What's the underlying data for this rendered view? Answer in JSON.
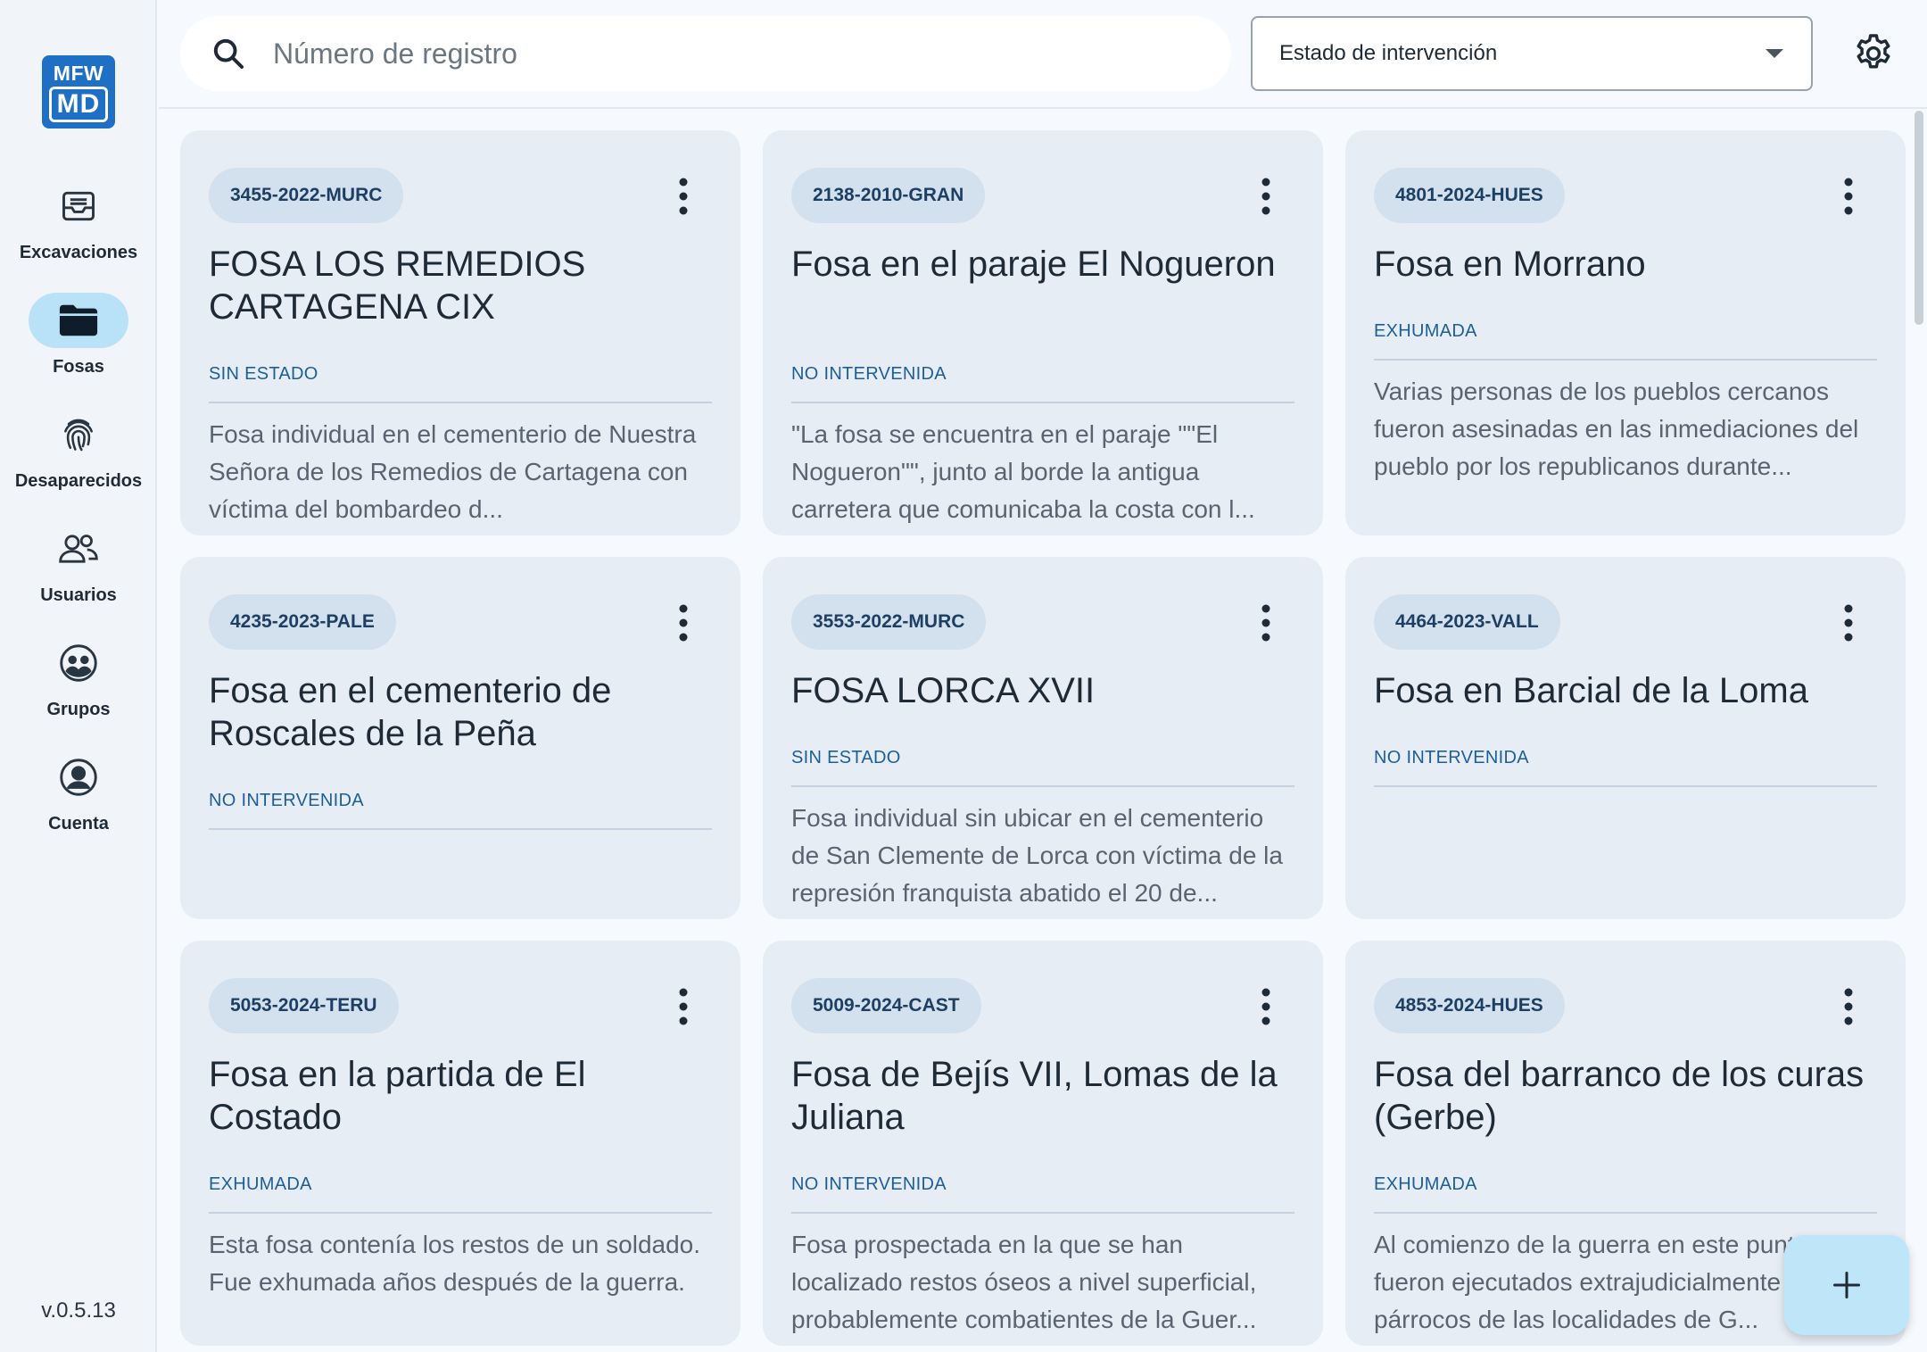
{
  "app": {
    "logo_top": "MFW",
    "logo_bottom": "MD",
    "version": "v.0.5.13"
  },
  "sidebar": {
    "items": [
      {
        "label": "Excavaciones",
        "icon": "inbox-icon"
      },
      {
        "label": "Fosas",
        "icon": "folder-icon",
        "active": true
      },
      {
        "label": "Desaparecidos",
        "icon": "fingerprint-icon"
      },
      {
        "label": "Usuarios",
        "icon": "users-icon"
      },
      {
        "label": "Grupos",
        "icon": "group-icon"
      },
      {
        "label": "Cuenta",
        "icon": "account-icon"
      }
    ]
  },
  "search": {
    "placeholder": "Número de registro",
    "value": ""
  },
  "filter": {
    "selected": "Estado de intervención"
  },
  "colors": {
    "accent": "#1f6fc5",
    "card_bg": "#e7edf5",
    "chip_bg": "#d3e0ee",
    "status": "#1d5e9a",
    "active_nav": "#b9e1f7"
  },
  "cards": [
    {
      "code": "3455-2022-MURC",
      "title": "FOSA LOS REMEDIOS CARTAGENA CIX",
      "status": "SIN ESTADO",
      "description": "Fosa individual en el cementerio de Nuestra Señora de los Remedios de Cartagena con víctima del bombardeo d..."
    },
    {
      "code": "2138-2010-GRAN",
      "title": "Fosa en el paraje El Nogueron",
      "status": "NO INTERVENIDA",
      "description": "\"La fosa se encuentra en el paraje \"\"El Nogueron\"\", junto al borde la antigua carretera que comunicaba la costa con l..."
    },
    {
      "code": "4801-2024-HUES",
      "title": "Fosa en Morrano",
      "status": "EXHUMADA",
      "description": "Varias personas de los pueblos cercanos fueron asesinadas en las inmediaciones del pueblo por los republicanos durante..."
    },
    {
      "code": "4235-2023-PALE",
      "title": "Fosa en el cementerio de Roscales de la Peña",
      "status": "NO INTERVENIDA",
      "description": ""
    },
    {
      "code": "3553-2022-MURC",
      "title": "FOSA LORCA XVII",
      "status": "SIN ESTADO",
      "description": "Fosa individual sin ubicar en el cementerio de San Clemente de Lorca con víctima de la represión franquista abatido el 20 de..."
    },
    {
      "code": "4464-2023-VALL",
      "title": "Fosa en Barcial de la Loma",
      "status": "NO INTERVENIDA",
      "description": ""
    },
    {
      "code": "5053-2024-TERU",
      "title": "Fosa en la partida de El Costado",
      "status": "EXHUMADA",
      "description": "Esta fosa contenía los restos de un soldado. Fue exhumada años después de la guerra."
    },
    {
      "code": "5009-2024-CAST",
      "title": "Fosa de Bejís VII, Lomas de la Juliana",
      "status": "NO INTERVENIDA",
      "description": "Fosa prospectada en la que se han localizado restos óseos a nivel superficial, probablemente combatientes de la Guer..."
    },
    {
      "code": "4853-2024-HUES",
      "title": "Fosa del barranco de los curas (Gerbe)",
      "status": "EXHUMADA",
      "description": "Al comienzo de la guerra en este punto fueron ejecutados extrajudicialmente tres párrocos de las localidades de G..."
    }
  ]
}
